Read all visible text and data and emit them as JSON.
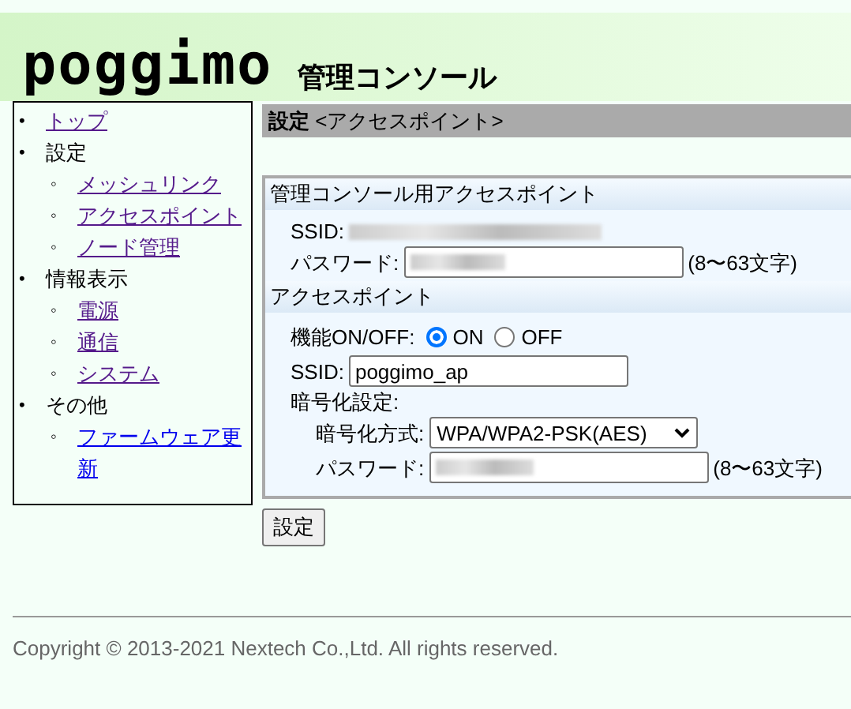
{
  "header": {
    "logo": "poggimo",
    "subtitle": "管理コンソール"
  },
  "sidebar": {
    "items": [
      {
        "marker": "•",
        "label": "トップ",
        "kind": "link",
        "visited": true
      },
      {
        "marker": "•",
        "label": "設定",
        "kind": "heading",
        "children": [
          {
            "marker": "◦",
            "label": "メッシュリンク",
            "kind": "link",
            "visited": true
          },
          {
            "marker": "◦",
            "label": "アクセスポイント",
            "kind": "link",
            "visited": true
          },
          {
            "marker": "◦",
            "label": "ノード管理",
            "kind": "link",
            "visited": true
          }
        ]
      },
      {
        "marker": "•",
        "label": "情報表示",
        "kind": "heading",
        "children": [
          {
            "marker": "◦",
            "label": "電源",
            "kind": "link",
            "visited": true
          },
          {
            "marker": "◦",
            "label": "通信",
            "kind": "link",
            "visited": true
          },
          {
            "marker": "◦",
            "label": "システム",
            "kind": "link",
            "visited": true
          }
        ]
      },
      {
        "marker": "•",
        "label": "その他",
        "kind": "heading",
        "children": [
          {
            "marker": "◦",
            "label": "ファームウェア更新",
            "kind": "link",
            "visited": false
          }
        ]
      }
    ]
  },
  "page_title": {
    "section": "設定",
    "sub": "<アクセスポイント>"
  },
  "console_ap": {
    "heading": "管理コンソール用アクセスポイント",
    "ssid_label": "SSID:",
    "password_label": "パスワード:",
    "password_hint": "(8〜63文字)"
  },
  "access_point": {
    "heading": "アクセスポイント",
    "function_label": "機能ON/OFF:",
    "options": [
      {
        "label": "ON",
        "selected": true
      },
      {
        "label": "OFF",
        "selected": false
      }
    ],
    "ssid_label": "SSID:",
    "ssid_value": "poggimo_ap",
    "encryption_label": "暗号化設定:",
    "method_label": "暗号化方式:",
    "method_value": "WPA/WPA2-PSK(AES)",
    "password_label": "パスワード:",
    "password_hint": "(8〜63文字)"
  },
  "submit": "設定",
  "footer": "Copyright © 2013-2021 Nextech Co.,Ltd. All rights reserved."
}
